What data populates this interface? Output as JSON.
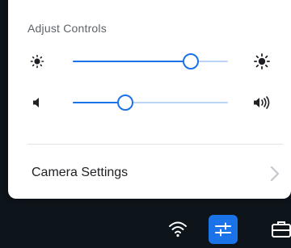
{
  "panel": {
    "title": "Adjust Controls"
  },
  "brightness": {
    "min_icon": "brightness-low-icon",
    "max_icon": "brightness-high-icon",
    "value_fraction": 0.76
  },
  "volume": {
    "min_icon": "volume-low-icon",
    "max_icon": "volume-high-icon",
    "value_fraction": 0.34
  },
  "camera": {
    "label": "Camera Settings",
    "chevron_icon": "chevron-right-icon"
  },
  "taskbar": {
    "items": [
      {
        "icon": "wifi-icon",
        "active": false
      },
      {
        "icon": "adjust-controls-icon",
        "active": true
      },
      {
        "icon": "briefcase-icon",
        "active": false
      }
    ]
  },
  "colors": {
    "accent": "#1a73e8",
    "track": "#b9d4f5",
    "taskbar": "#0d141a",
    "panel": "#ffffff"
  }
}
